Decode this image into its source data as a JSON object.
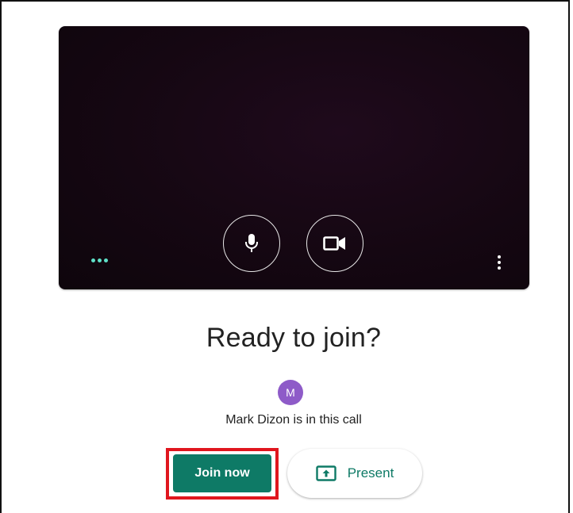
{
  "preview": {
    "background_color": "#150712",
    "mic_icon": "microphone-icon",
    "camera_icon": "video-camera-icon",
    "visual_effects_icon": "sparkle-dots-icon",
    "more_options_icon": "more-vertical-icon"
  },
  "join_panel": {
    "title": "Ready to join?",
    "participant_initial": "M",
    "participant_avatar_color": "#8e5bc8",
    "participants_text": "Mark Dizon is in this call",
    "join_button_label": "Join now",
    "present_button_label": "Present",
    "accent_color": "#0e7a66",
    "highlight_color": "#e0161e"
  }
}
